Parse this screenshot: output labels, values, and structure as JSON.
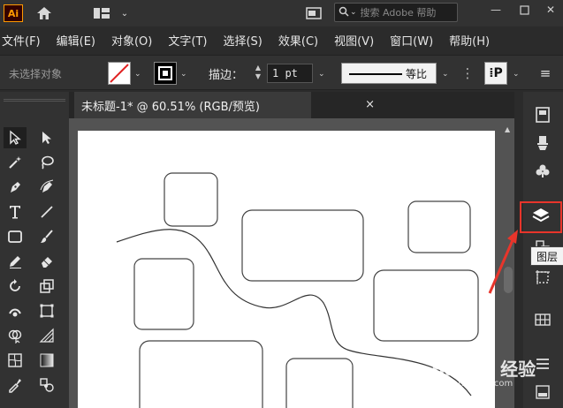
{
  "app": {
    "logo_text": "Ai",
    "search_placeholder": "搜索 Adobe 帮助"
  },
  "menu": {
    "items": [
      "文件(F)",
      "编辑(E)",
      "对象(O)",
      "文字(T)",
      "选择(S)",
      "效果(C)",
      "视图(V)",
      "窗口(W)",
      "帮助(H)"
    ]
  },
  "controlbar": {
    "selection_status": "未选择对象",
    "stroke_label": "描边：",
    "stroke_weight": "1 pt",
    "profile_label": "等比"
  },
  "document": {
    "tab_title": "未标题-1* @ 60.51% (RGB/预览)",
    "close_glyph": "×"
  },
  "right_panel": {
    "tooltip": "图层"
  },
  "watermark": {
    "main": "Bai du 经验",
    "sub": "jingyan.baidu.com"
  },
  "colors": {
    "highlight": "#e8352b",
    "accent": "#ff9a00"
  },
  "icons": {
    "home": "home-icon",
    "workspace": "workspace-icon",
    "layers": "layers-icon",
    "search": "search-icon"
  }
}
